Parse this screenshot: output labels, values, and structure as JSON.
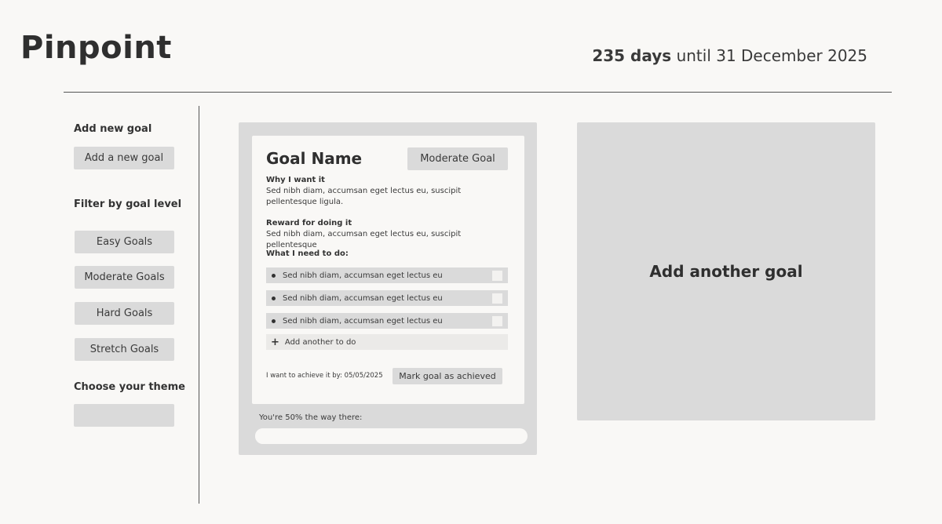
{
  "header": {
    "brand": "Pinpoint",
    "days_count": "235 days",
    "until_text": "until 31 December 2025"
  },
  "sidebar": {
    "add_heading": "Add new goal",
    "add_button": "Add a new goal",
    "filter_heading": "Filter by goal level",
    "filters": [
      "Easy Goals",
      "Moderate Goals",
      "Hard Goals",
      "Stretch Goals"
    ],
    "theme_heading": "Choose your theme",
    "theme_value": ""
  },
  "goal": {
    "name": "Goal Name",
    "level": "Moderate Goal",
    "why_label": "Why I want it",
    "why_text": "Sed nibh diam, accumsan eget lectus eu, suscipit pellentesque ligula.",
    "reward_label": "Reward for doing it",
    "reward_text": "Sed nibh diam, accumsan eget lectus eu, suscipit pellentesque",
    "todo_label": "What I need to do:",
    "todos": [
      {
        "text": "Sed nibh diam, accumsan eget lectus eu",
        "checked": false
      },
      {
        "text": "Sed nibh diam, accumsan eget lectus eu",
        "checked": false
      },
      {
        "text": "Sed nibh diam, accumsan eget lectus eu",
        "checked": false
      }
    ],
    "add_todo": "Add another to do",
    "deadline_text": "I want to achieve it by: 05/05/2025",
    "achieve_button": "Mark goal as achieved",
    "progress_label": "You're 50% the way there:",
    "progress_fraction": 0.5
  },
  "add_goal_panel": {
    "label": "Add another goal"
  }
}
